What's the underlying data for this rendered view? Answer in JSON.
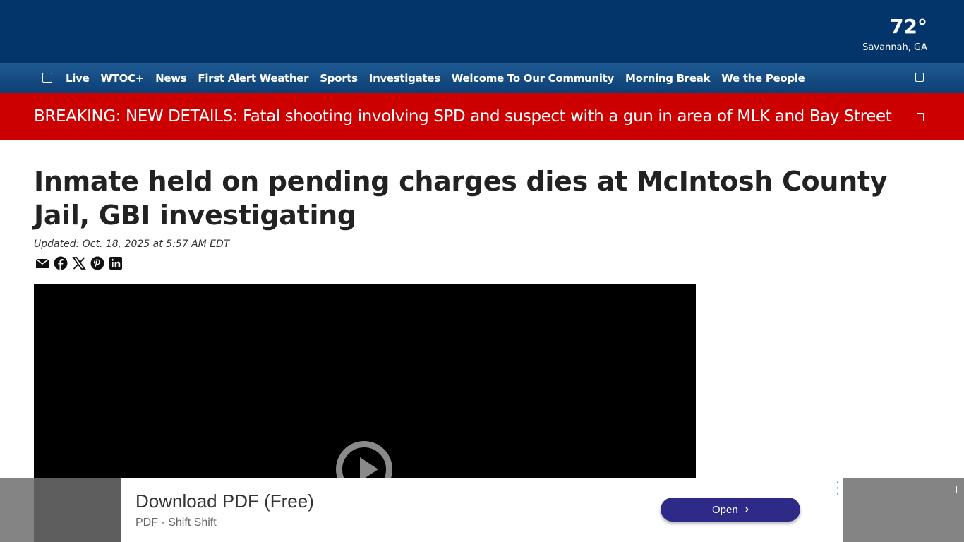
{
  "header": {
    "temperature": "72°",
    "location": "Savannah, GA"
  },
  "nav": {
    "menu_icon": "hamburger-icon",
    "items": [
      "Live",
      "WTOC+",
      "News",
      "First Alert Weather",
      "Sports",
      "Investigates",
      "Welcome To Our Community",
      "Morning Break",
      "We the People"
    ],
    "search_icon": "search-icon"
  },
  "breaking": {
    "text": "BREAKING: NEW DETAILS: Fatal shooting involving SPD and suspect with a gun in area of MLK and Bay Street",
    "close_icon": "close-icon"
  },
  "article": {
    "headline": "Inmate held on pending charges dies at McIntosh County Jail, GBI investigating",
    "updated": "Updated: Oct. 18, 2025 at 5:57 AM EDT",
    "share_icons": [
      "email-icon",
      "facebook-icon",
      "x-icon",
      "pinterest-icon",
      "linkedin-icon"
    ]
  },
  "ad": {
    "title": "Download PDF (Free)",
    "subtitle": "PDF - Shift Shift",
    "button_label": "Open"
  },
  "colors": {
    "header_bg": "#03356b",
    "breaking_bg": "#cc0000",
    "ad_button": "#2d2b87"
  }
}
